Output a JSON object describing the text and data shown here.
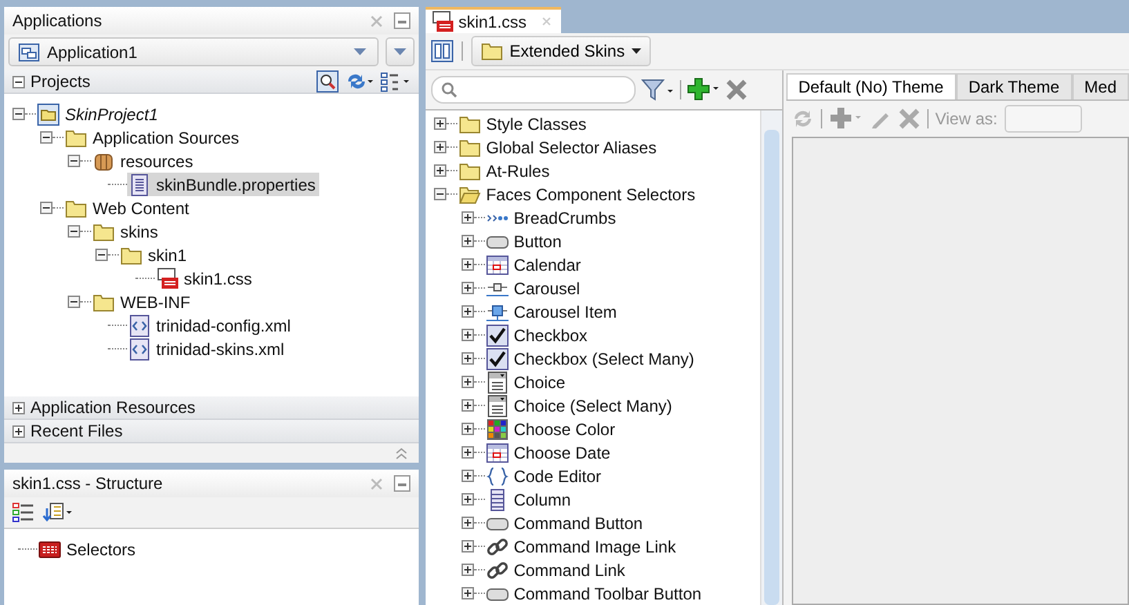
{
  "applications_panel": {
    "title": "Applications",
    "application": "Application1",
    "projects": {
      "label": "Projects",
      "expanded": true,
      "tree": [
        {
          "label": "SkinProject1",
          "kind": "project",
          "expanded": true,
          "selected": false,
          "children": [
            {
              "label": "Application Sources",
              "kind": "folder",
              "expanded": true,
              "selected": false,
              "children": [
                {
                  "label": "resources",
                  "kind": "package",
                  "expanded": true,
                  "selected": false,
                  "children": [
                    {
                      "label": "skinBundle.properties",
                      "kind": "properties",
                      "selected": true
                    }
                  ]
                }
              ]
            },
            {
              "label": "Web Content",
              "kind": "folder",
              "expanded": true,
              "selected": false,
              "children": [
                {
                  "label": "skins",
                  "kind": "folder",
                  "expanded": true,
                  "selected": false,
                  "children": [
                    {
                      "label": "skin1",
                      "kind": "folder",
                      "expanded": true,
                      "selected": false,
                      "children": [
                        {
                          "label": "skin1.css",
                          "kind": "css",
                          "selected": false
                        }
                      ]
                    }
                  ]
                },
                {
                  "label": "WEB-INF",
                  "kind": "folder",
                  "expanded": true,
                  "selected": false,
                  "children": [
                    {
                      "label": "trinidad-config.xml",
                      "kind": "xml",
                      "selected": false
                    },
                    {
                      "label": "trinidad-skins.xml",
                      "kind": "xml",
                      "selected": false
                    }
                  ]
                }
              ]
            }
          ]
        }
      ]
    },
    "sections": [
      {
        "label": "Application Resources",
        "expanded": false
      },
      {
        "label": "Recent Files",
        "expanded": false
      }
    ]
  },
  "structure_panel": {
    "title": "skin1.css - Structure",
    "tree": [
      {
        "label": "Selectors",
        "kind": "css-badge",
        "selected": false
      }
    ]
  },
  "editor": {
    "tab": {
      "label": "skin1.css"
    },
    "skin_menu": "Extended Skins",
    "selectors": [
      {
        "label": "Style Classes",
        "kind": "folder",
        "expanded": false,
        "selected": false
      },
      {
        "label": "Global Selector Aliases",
        "kind": "folder",
        "expanded": false,
        "selected": false
      },
      {
        "label": "At-Rules",
        "kind": "folder",
        "expanded": false,
        "selected": false
      },
      {
        "label": "Faces Component Selectors",
        "kind": "folder-open",
        "expanded": true,
        "selected": false,
        "children": [
          {
            "label": "BreadCrumbs",
            "kind": "breadcrumbs",
            "expanded": false,
            "selected": false
          },
          {
            "label": "Button",
            "kind": "button",
            "expanded": false,
            "selected": false
          },
          {
            "label": "Calendar",
            "kind": "calendar",
            "expanded": false,
            "selected": false
          },
          {
            "label": "Carousel",
            "kind": "carousel",
            "expanded": false,
            "selected": false
          },
          {
            "label": "Carousel Item",
            "kind": "carousel-item",
            "expanded": false,
            "selected": false
          },
          {
            "label": "Checkbox",
            "kind": "checkbox",
            "expanded": false,
            "selected": false
          },
          {
            "label": "Checkbox (Select Many)",
            "kind": "checkbox",
            "expanded": false,
            "selected": false
          },
          {
            "label": "Choice",
            "kind": "choice",
            "expanded": false,
            "selected": false
          },
          {
            "label": "Choice (Select Many)",
            "kind": "choice",
            "expanded": false,
            "selected": false
          },
          {
            "label": "Choose Color",
            "kind": "color",
            "expanded": false,
            "selected": false
          },
          {
            "label": "Choose Date",
            "kind": "calendar",
            "expanded": false,
            "selected": false
          },
          {
            "label": "Code Editor",
            "kind": "braces",
            "expanded": false,
            "selected": false
          },
          {
            "label": "Column",
            "kind": "column",
            "expanded": false,
            "selected": false
          },
          {
            "label": "Command Button",
            "kind": "button",
            "expanded": false,
            "selected": false
          },
          {
            "label": "Command Image Link",
            "kind": "link",
            "expanded": false,
            "selected": false
          },
          {
            "label": "Command Link",
            "kind": "link",
            "expanded": false,
            "selected": false
          },
          {
            "label": "Command Toolbar Button",
            "kind": "button",
            "expanded": false,
            "selected": false
          }
        ]
      }
    ],
    "theme_tabs": [
      {
        "label": "Default (No) Theme",
        "selected": true
      },
      {
        "label": "Dark Theme",
        "selected": false
      },
      {
        "label": "Med",
        "selected": false
      }
    ],
    "view_as_label": "View as:"
  }
}
